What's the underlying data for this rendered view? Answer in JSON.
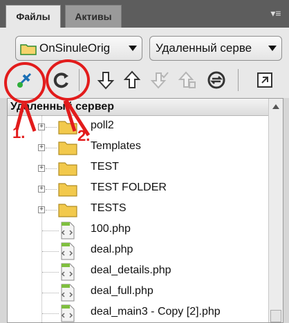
{
  "tabs": [
    {
      "label": "Файлы",
      "active": true
    },
    {
      "label": "Активы",
      "active": false
    }
  ],
  "panel_menu_icon": "panel-options-icon",
  "site_select": {
    "value": "OnSinuleOrig",
    "icon": "folder-icon"
  },
  "view_select": {
    "value": "Удаленный серве"
  },
  "toolbar": [
    {
      "name": "connect-button",
      "icon": "connect-icon",
      "enabled": true
    },
    {
      "name": "refresh-button",
      "icon": "refresh-icon",
      "enabled": true
    },
    {
      "name": "get-button",
      "icon": "arrow-down-icon",
      "enabled": true
    },
    {
      "name": "put-button",
      "icon": "arrow-up-icon",
      "enabled": true
    },
    {
      "name": "checkout-button",
      "icon": "check-out-icon",
      "enabled": false
    },
    {
      "name": "checkin-button",
      "icon": "check-in-icon",
      "enabled": false
    },
    {
      "name": "sync-button",
      "icon": "sync-icon",
      "enabled": true
    },
    {
      "name": "expand-button",
      "icon": "expand-icon",
      "enabled": true
    }
  ],
  "tree": {
    "header": "Удаленный сервер",
    "items": [
      {
        "label": "poll2",
        "type": "folder"
      },
      {
        "label": "Templates",
        "type": "folder"
      },
      {
        "label": "TEST",
        "type": "folder"
      },
      {
        "label": "TEST FOLDER",
        "type": "folder"
      },
      {
        "label": "TESTS",
        "type": "folder"
      },
      {
        "label": "100.php",
        "type": "file"
      },
      {
        "label": "deal.php",
        "type": "file"
      },
      {
        "label": "deal_details.php",
        "type": "file"
      },
      {
        "label": "deal_full.php",
        "type": "file"
      },
      {
        "label": "deal_main3 - Copy [2].php",
        "type": "file"
      }
    ]
  },
  "annotations": {
    "first": "1.",
    "second": "2."
  },
  "colors": {
    "annotation": "#e21c1c",
    "tab_strip": "#5d5d5d",
    "folder": "#f2c94c"
  }
}
